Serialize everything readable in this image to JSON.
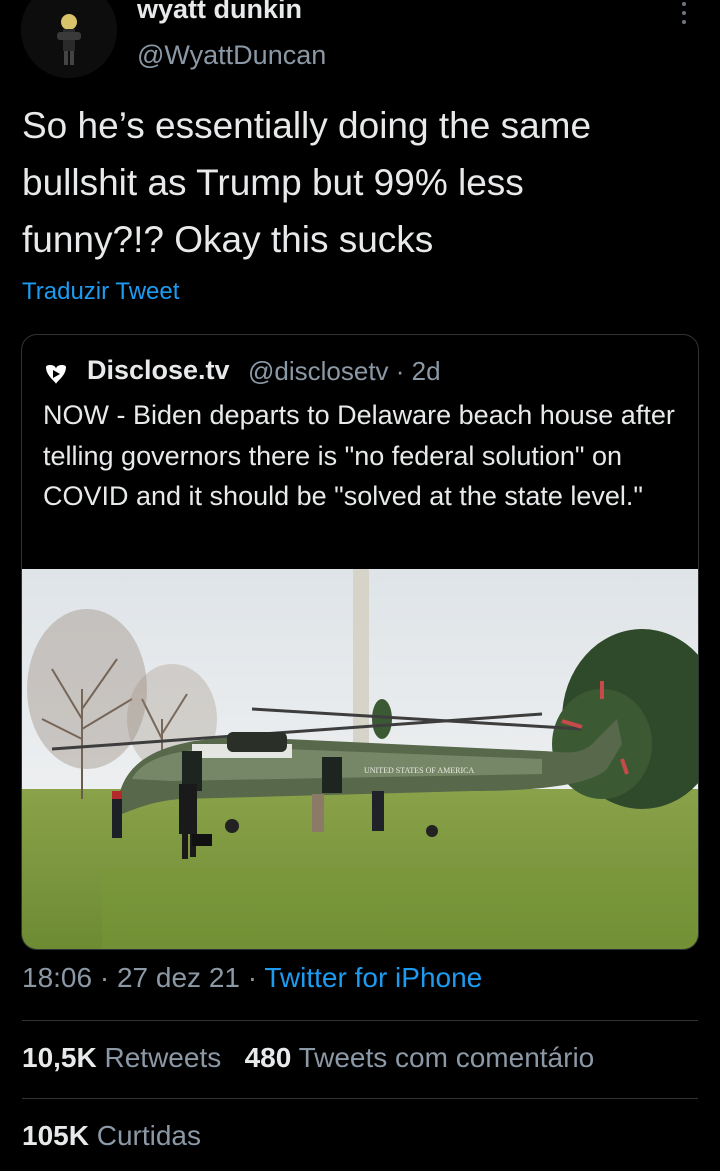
{
  "author": {
    "name": "wyatt dunkin",
    "handle": "@WyattDuncan",
    "avatar_icon": "user-avatar"
  },
  "tweet": {
    "text": "So he’s essentially doing the same\nbullshit as Trump but 99% less\nfunny?!? Okay this sucks",
    "translate_label": "Traduzir Tweet"
  },
  "quoted_tweet": {
    "source_icon": "disclosetv-logo-icon",
    "name": "Disclose.tv",
    "meta": "@disclosetv · 2d",
    "text": "NOW - Biden departs to Delaware beach house after telling governors there is \"no federal solution\" on COVID and it should be \"solved at the state level.\"",
    "image_label": "UNITED STATES OF AMERICA"
  },
  "meta": {
    "time": "18:06",
    "sep1": " · ",
    "date": "27 dez 21",
    "sep2": " · ",
    "source": "Twitter for iPhone"
  },
  "stats": {
    "retweets_count": "10,5K",
    "retweets_label": "Retweets",
    "quotes_count": "480",
    "quotes_label": "Tweets com comentário",
    "likes_count": "105K",
    "likes_label": "Curtidas"
  },
  "colors": {
    "background": "#000000",
    "link_blue": "#1d9bf0",
    "secondary_text": "#8b98a5"
  }
}
